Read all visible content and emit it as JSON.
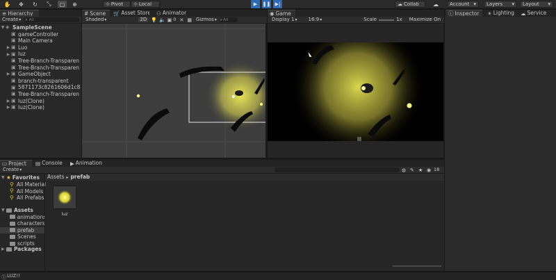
{
  "toolbar": {
    "pivot": "Pivot",
    "local": "Local",
    "collab": "Collab",
    "account": "Account",
    "layers": "Layers",
    "layout": "Layout",
    "icons": [
      "hand-icon",
      "move-icon",
      "rotate-icon",
      "scale-icon",
      "rect-icon",
      "transform-icon"
    ]
  },
  "hierarchy": {
    "tab": "Hierarchy",
    "create": "Create",
    "search_placeholder": "All",
    "scene": "SampleScene",
    "items": [
      {
        "label": "gameController",
        "arrow": ""
      },
      {
        "label": "Main Camera",
        "arrow": ""
      },
      {
        "label": "Luo",
        "arrow": "▶"
      },
      {
        "label": "luz",
        "arrow": "▶"
      },
      {
        "label": "Tree-Branch-Transparen",
        "arrow": ""
      },
      {
        "label": "Tree-Branch-Transparen",
        "arrow": ""
      },
      {
        "label": "GameObject",
        "arrow": "▶"
      },
      {
        "label": "branch-transparent",
        "arrow": ""
      },
      {
        "label": "5871173c8261606d1c8",
        "arrow": ""
      },
      {
        "label": "Tree-Branch-Transparen",
        "arrow": ""
      },
      {
        "label": "luz(Clone)",
        "arrow": "▶"
      },
      {
        "label": "luz(Clone)",
        "arrow": "▶"
      }
    ]
  },
  "scene": {
    "tabs": {
      "scene": "Scene",
      "asset_store": "Asset Store",
      "animator": "Animator"
    },
    "shading": "Shaded",
    "mode_2d": "2D",
    "fx_count": "0",
    "gizmos": "Gizmos",
    "search_placeholder": "All"
  },
  "game": {
    "tab": "Game",
    "display": "Display 1",
    "aspect": "16:9",
    "scale_label": "Scale",
    "scale_value": "1x",
    "maximize": "Maximize On"
  },
  "inspector": {
    "tabs": {
      "inspector": "Inspector",
      "lighting": "Lighting",
      "services": "Service"
    }
  },
  "project": {
    "tabs": {
      "project": "Project",
      "console": "Console",
      "animation": "Animation"
    },
    "create": "Create",
    "favorites_label": "Favorites",
    "favorites": [
      "All Material",
      "All Models",
      "All Prefabs"
    ],
    "assets_label": "Assets",
    "asset_folders": [
      "animations",
      "characters",
      "prefab",
      "Scenes",
      "scripts"
    ],
    "packages_label": "Packages",
    "breadcrumb": {
      "root": "Assets",
      "separator": "▸",
      "current": "prefab"
    },
    "items": [
      {
        "label": "luz"
      }
    ],
    "hidden_count": "18"
  },
  "status": {
    "text": "LUZ!!"
  },
  "colors": {
    "accent": "#2e6ab1",
    "glow": "#f0ee58",
    "light": "#fdff8a"
  }
}
